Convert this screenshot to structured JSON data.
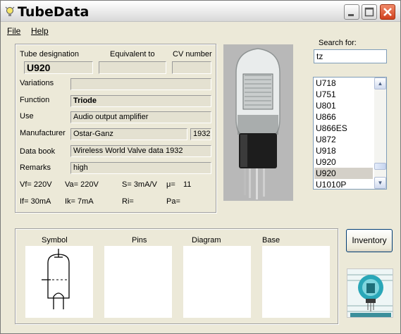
{
  "window": {
    "title": "TubeData"
  },
  "menu": {
    "file": "File",
    "help": "Help"
  },
  "tube": {
    "designation_label": "Tube designation",
    "equivalent_label": "Equivalent to",
    "cv_label": "CV number",
    "designation": "U920",
    "equivalent": "",
    "cv_number": "",
    "variations_label": "Variations",
    "variations": "",
    "function_label": "Function",
    "function": "Triode",
    "use_label": "Use",
    "use": "Audio output amplifier",
    "manufacturer_label": "Manufacturer",
    "manufacturer": "Ostar-Ganz",
    "year": "1932",
    "databook_label": "Data book",
    "databook": "Wireless World Valve data 1932",
    "remarks_label": "Remarks",
    "remarks": "high"
  },
  "params": {
    "vf": "Vf= 220V",
    "va": "Va= 220V",
    "s": "S= 3mA/V",
    "mu_label": "μ=",
    "mu": "11",
    "if": "If= 30mA",
    "ik": "Ik= 7mA",
    "ri": "Ri=",
    "pa": "Pa="
  },
  "search": {
    "label": "Search for:",
    "value": "tz",
    "results": [
      "U718",
      "U751",
      "U801",
      "U866",
      "U866ES",
      "U872",
      "U918",
      "U920",
      "U920",
      "U1010P"
    ],
    "selected_index": 8
  },
  "panels": {
    "symbol": "Symbol",
    "pins": "Pins",
    "diagram": "Diagram",
    "base": "Base"
  },
  "inventory_button": "Inventory",
  "colors": {
    "face": "#ECE9D8",
    "field": "#E4E1D1",
    "selection": "#D4D0C8",
    "close": "#D0401E"
  },
  "icons": [
    "bulb-icon",
    "minimize-icon",
    "maximize-icon",
    "close-icon",
    "scroll-up-icon",
    "scroll-down-icon"
  ]
}
